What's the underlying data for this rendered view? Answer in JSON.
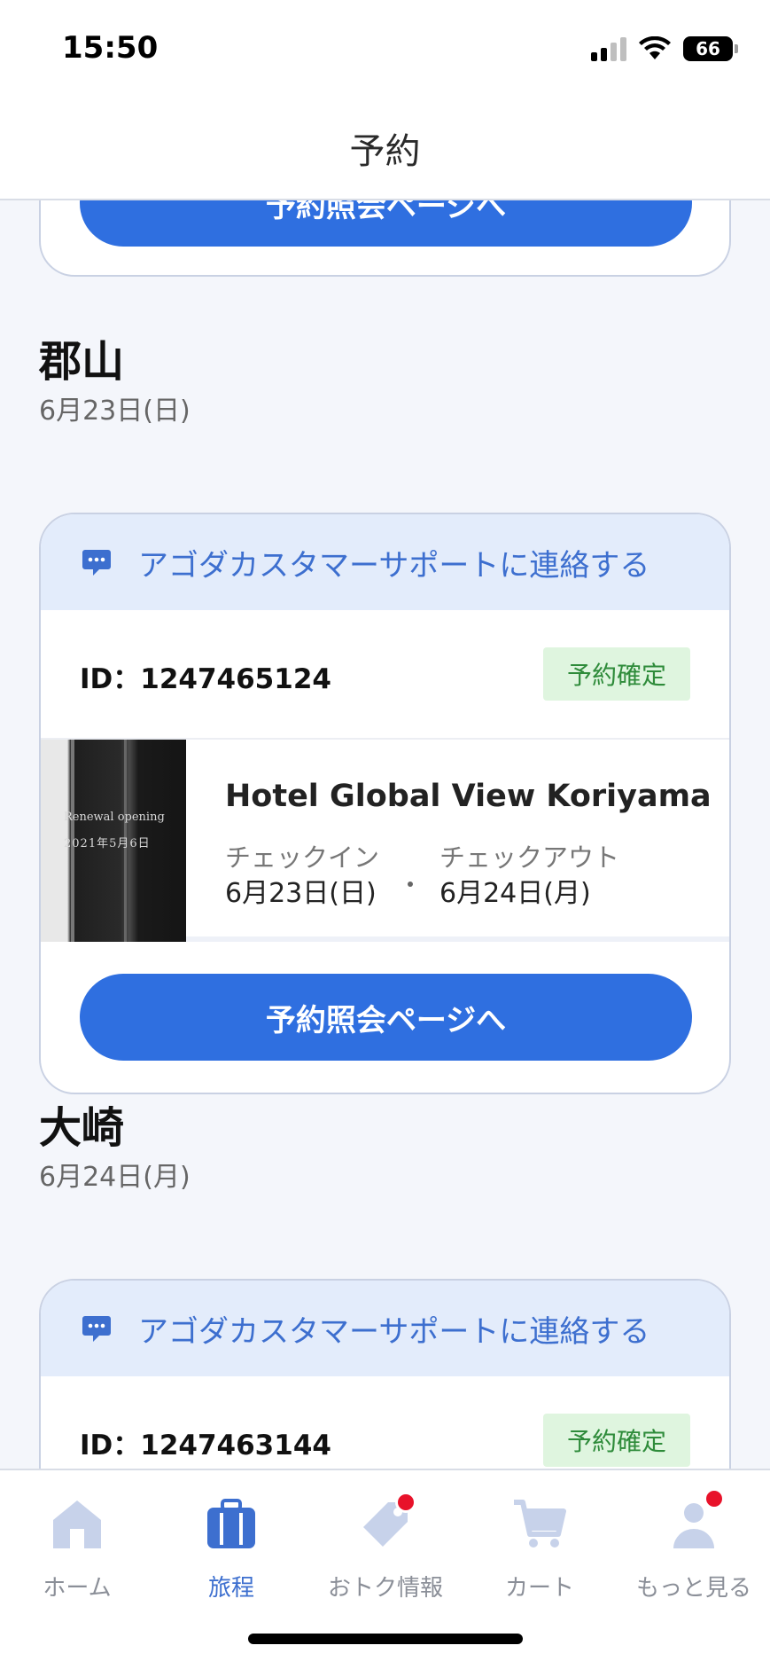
{
  "status_bar": {
    "time": "15:50",
    "battery": "66"
  },
  "header": {
    "title": "予約"
  },
  "top_card": {
    "button_label": "予約照会ページへ"
  },
  "bookings": [
    {
      "city": "郡山",
      "date": "6月23日(日)",
      "support_label": "アゴダカスタマーサポートに連絡する",
      "id_text": "ID：1247465124",
      "status": "予約確定",
      "hotel_name": "Hotel Global View Koriyama",
      "hotel_image_text_1": "Renewal opening",
      "hotel_image_text_2": "2021年5月6日",
      "checkin_label": "チェックイン",
      "checkin_date": "6月23日(日)",
      "checkout_label": "チェックアウト",
      "checkout_date": "6月24日(月)",
      "button_label": "予約照会ページへ"
    },
    {
      "city": "大崎",
      "date": "6月24日(月)",
      "support_label": "アゴダカスタマーサポートに連絡する",
      "id_text": "ID：1247463144",
      "status": "予約確定"
    }
  ],
  "bottom_nav": [
    {
      "label": "ホーム",
      "icon": "home-icon",
      "active": false
    },
    {
      "label": "旅程",
      "icon": "suitcase-icon",
      "active": true
    },
    {
      "label": "おトク情報",
      "icon": "tag-icon",
      "active": false,
      "badge": true
    },
    {
      "label": "カート",
      "icon": "cart-icon",
      "active": false
    },
    {
      "label": "もっと見る",
      "icon": "person-icon",
      "active": false,
      "badge": true
    }
  ],
  "colors": {
    "primary": "#2f6fe0",
    "support_bg": "#e3ecfb",
    "badge_bg": "#dff5df",
    "badge_text": "#2e8b3a",
    "nav_active": "#3d6fcf",
    "notification": "#e8122a"
  }
}
